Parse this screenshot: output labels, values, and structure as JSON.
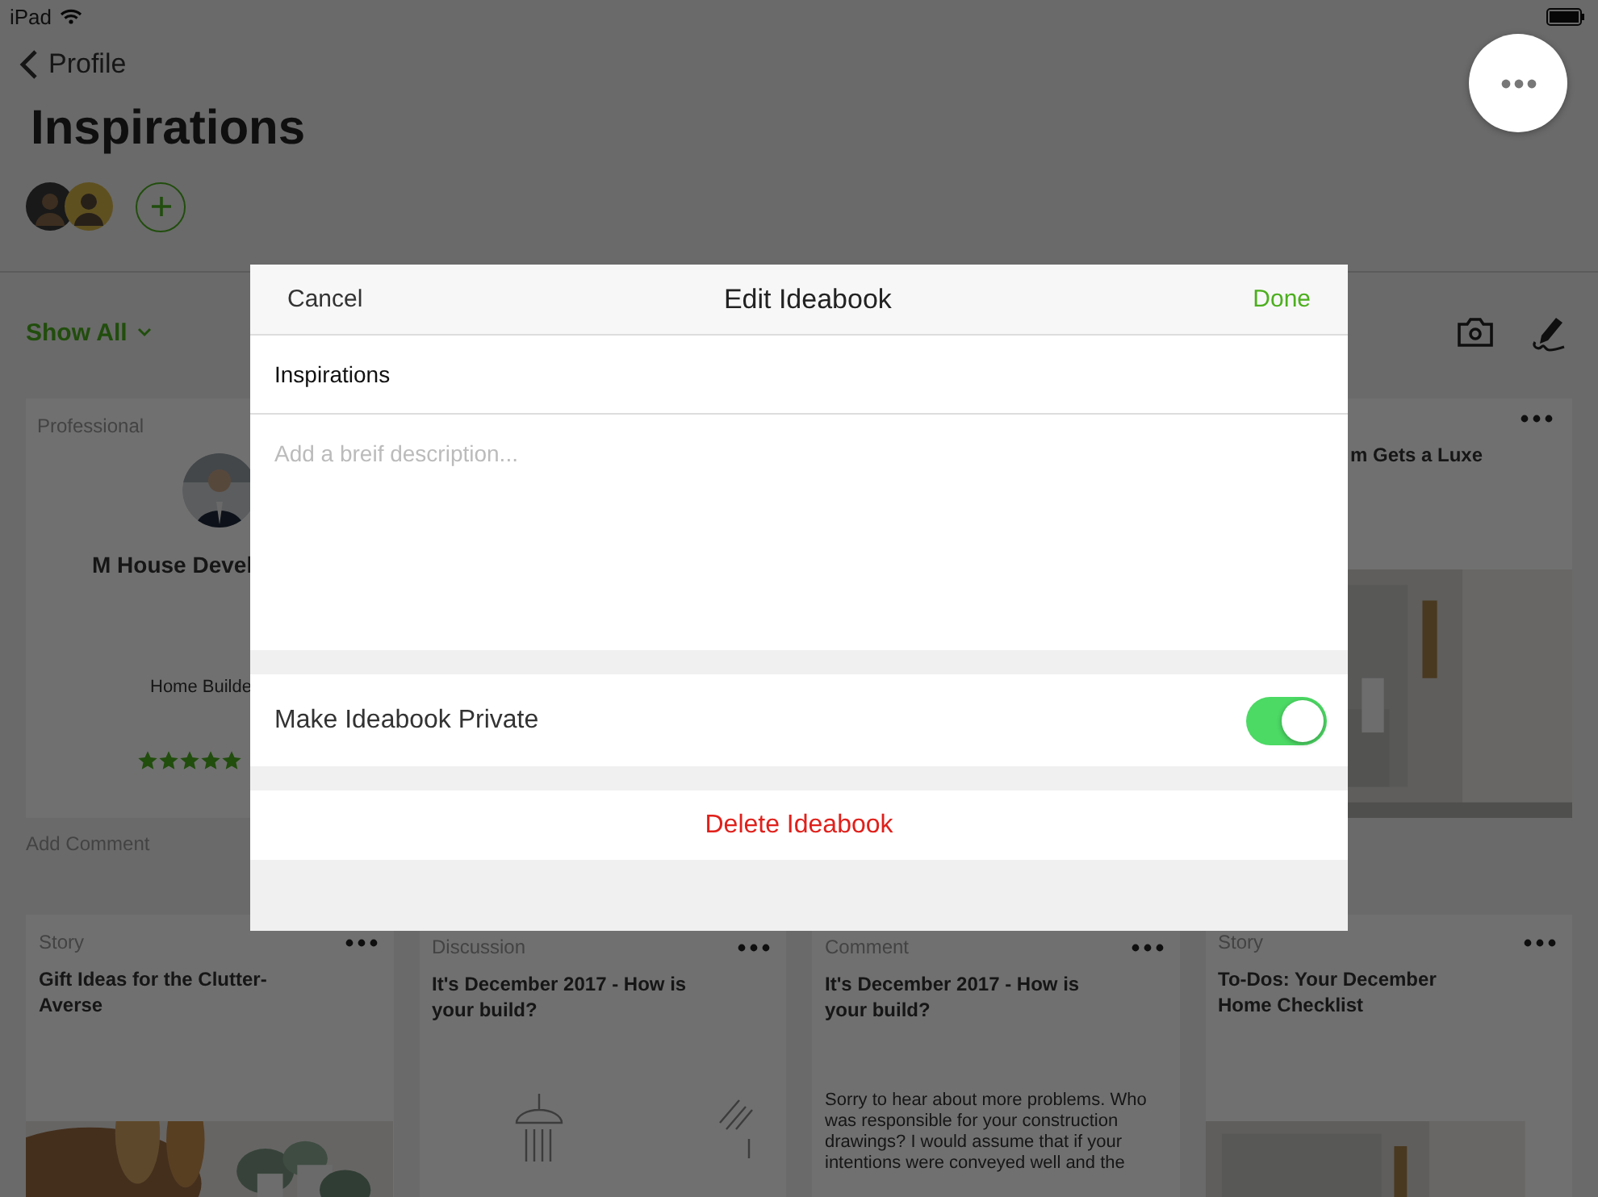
{
  "status_bar": {
    "device": "iPad"
  },
  "nav": {
    "back": "Profile"
  },
  "title": "Inspirations",
  "filter": {
    "label": "Show All"
  },
  "cards_top": [
    {
      "kind": "professional",
      "type_label": "Professional",
      "name": "M House Devel",
      "category": "Home Builde",
      "stars": 5
    },
    {
      "kind": "hidden"
    },
    {
      "kind": "hidden"
    },
    {
      "title": "m Gets a Luxe"
    }
  ],
  "add_comment": "Add Comment",
  "cards": [
    {
      "type_label": "Story",
      "title": "Gift Ideas for the Clutter-Averse"
    },
    {
      "kind": "sketch",
      "type_label": "Discussion",
      "title": "It's December 2017 - How is your build?"
    },
    {
      "kind": "comment",
      "type_label": "Comment",
      "title": "It's December 2017 - How is your build?",
      "body": "Sorry to hear about more problems. Who was responsible for your construction drawings? I would assume that if your intentions were conveyed well and the"
    },
    {
      "type_label": "Story",
      "title": "To-Dos: Your December Home Checklist"
    }
  ],
  "modal": {
    "cancel": "Cancel",
    "title": "Edit Ideabook",
    "done": "Done",
    "name_value": "Inspirations",
    "description_placeholder": "Add a breif description...",
    "private_label": "Make Ideabook Private",
    "private_on": true,
    "delete": "Delete Ideabook"
  }
}
